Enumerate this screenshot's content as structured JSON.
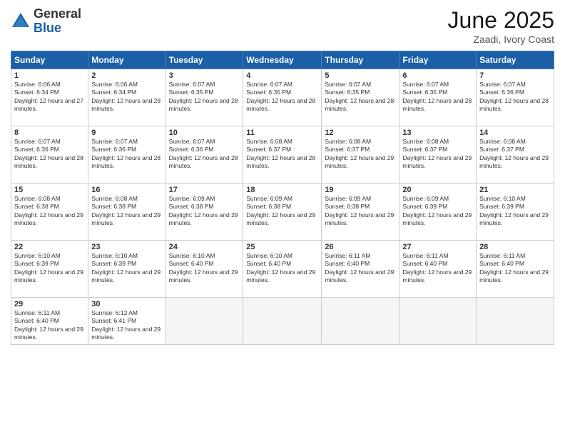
{
  "logo": {
    "general": "General",
    "blue": "Blue"
  },
  "title": "June 2025",
  "location": "Zaadi, Ivory Coast",
  "weekdays": [
    "Sunday",
    "Monday",
    "Tuesday",
    "Wednesday",
    "Thursday",
    "Friday",
    "Saturday"
  ],
  "weeks": [
    [
      {
        "day": "1",
        "sunrise": "6:06 AM",
        "sunset": "6:34 PM",
        "daylight": "12 hours and 27 minutes."
      },
      {
        "day": "2",
        "sunrise": "6:06 AM",
        "sunset": "6:34 PM",
        "daylight": "12 hours and 28 minutes."
      },
      {
        "day": "3",
        "sunrise": "6:07 AM",
        "sunset": "6:35 PM",
        "daylight": "12 hours and 28 minutes."
      },
      {
        "day": "4",
        "sunrise": "6:07 AM",
        "sunset": "6:35 PM",
        "daylight": "12 hours and 28 minutes."
      },
      {
        "day": "5",
        "sunrise": "6:07 AM",
        "sunset": "6:35 PM",
        "daylight": "12 hours and 28 minutes."
      },
      {
        "day": "6",
        "sunrise": "6:07 AM",
        "sunset": "6:35 PM",
        "daylight": "12 hours and 28 minutes."
      },
      {
        "day": "7",
        "sunrise": "6:07 AM",
        "sunset": "6:36 PM",
        "daylight": "12 hours and 28 minutes."
      }
    ],
    [
      {
        "day": "8",
        "sunrise": "6:07 AM",
        "sunset": "6:36 PM",
        "daylight": "12 hours and 28 minutes."
      },
      {
        "day": "9",
        "sunrise": "6:07 AM",
        "sunset": "6:36 PM",
        "daylight": "12 hours and 28 minutes."
      },
      {
        "day": "10",
        "sunrise": "6:07 AM",
        "sunset": "6:36 PM",
        "daylight": "12 hours and 28 minutes."
      },
      {
        "day": "11",
        "sunrise": "6:08 AM",
        "sunset": "6:37 PM",
        "daylight": "12 hours and 28 minutes."
      },
      {
        "day": "12",
        "sunrise": "6:08 AM",
        "sunset": "6:37 PM",
        "daylight": "12 hours and 29 minutes."
      },
      {
        "day": "13",
        "sunrise": "6:08 AM",
        "sunset": "6:37 PM",
        "daylight": "12 hours and 29 minutes."
      },
      {
        "day": "14",
        "sunrise": "6:08 AM",
        "sunset": "6:37 PM",
        "daylight": "12 hours and 29 minutes."
      }
    ],
    [
      {
        "day": "15",
        "sunrise": "6:08 AM",
        "sunset": "6:38 PM",
        "daylight": "12 hours and 29 minutes."
      },
      {
        "day": "16",
        "sunrise": "6:08 AM",
        "sunset": "6:38 PM",
        "daylight": "12 hours and 29 minutes."
      },
      {
        "day": "17",
        "sunrise": "6:09 AM",
        "sunset": "6:38 PM",
        "daylight": "12 hours and 29 minutes."
      },
      {
        "day": "18",
        "sunrise": "6:09 AM",
        "sunset": "6:38 PM",
        "daylight": "12 hours and 29 minutes."
      },
      {
        "day": "19",
        "sunrise": "6:09 AM",
        "sunset": "6:38 PM",
        "daylight": "12 hours and 29 minutes."
      },
      {
        "day": "20",
        "sunrise": "6:09 AM",
        "sunset": "6:39 PM",
        "daylight": "12 hours and 29 minutes."
      },
      {
        "day": "21",
        "sunrise": "6:10 AM",
        "sunset": "6:39 PM",
        "daylight": "12 hours and 29 minutes."
      }
    ],
    [
      {
        "day": "22",
        "sunrise": "6:10 AM",
        "sunset": "6:39 PM",
        "daylight": "12 hours and 29 minutes."
      },
      {
        "day": "23",
        "sunrise": "6:10 AM",
        "sunset": "6:39 PM",
        "daylight": "12 hours and 29 minutes."
      },
      {
        "day": "24",
        "sunrise": "6:10 AM",
        "sunset": "6:40 PM",
        "daylight": "12 hours and 29 minutes."
      },
      {
        "day": "25",
        "sunrise": "6:10 AM",
        "sunset": "6:40 PM",
        "daylight": "12 hours and 29 minutes."
      },
      {
        "day": "26",
        "sunrise": "6:11 AM",
        "sunset": "6:40 PM",
        "daylight": "12 hours and 29 minutes."
      },
      {
        "day": "27",
        "sunrise": "6:11 AM",
        "sunset": "6:40 PM",
        "daylight": "12 hours and 29 minutes."
      },
      {
        "day": "28",
        "sunrise": "6:11 AM",
        "sunset": "6:40 PM",
        "daylight": "12 hours and 29 minutes."
      }
    ],
    [
      {
        "day": "29",
        "sunrise": "6:11 AM",
        "sunset": "6:40 PM",
        "daylight": "12 hours and 29 minutes."
      },
      {
        "day": "30",
        "sunrise": "6:12 AM",
        "sunset": "6:41 PM",
        "daylight": "12 hours and 29 minutes."
      },
      null,
      null,
      null,
      null,
      null
    ]
  ]
}
